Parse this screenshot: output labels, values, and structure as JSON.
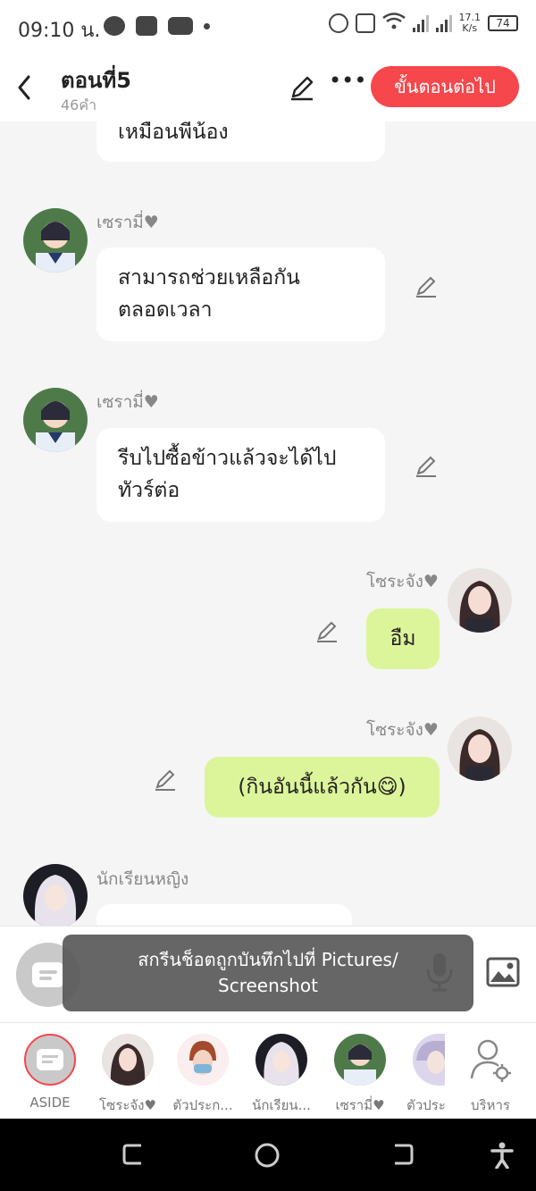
{
  "status_bar": {
    "time": "09:10 น.",
    "net_speed_value": "17.1",
    "net_speed_unit": "K/s",
    "battery": "74"
  },
  "header": {
    "title": "ตอนที่5",
    "subtitle": "46คำ",
    "next_button": "ขั้นตอนต่อไป"
  },
  "messages": [
    {
      "side": "left",
      "name": "",
      "text": "เหมือนพี่น้อง"
    },
    {
      "side": "left",
      "name": "เซรามี่♥",
      "line1": "สามารถช่วยเหลือกัน",
      "line2": "ตลอดเวลา"
    },
    {
      "side": "left",
      "name": "เซรามี่♥",
      "line1": "รีบไปซื้อข้าวแล้วจะได้ไป",
      "line2": "ทัวร์ต่อ"
    },
    {
      "side": "right",
      "name": "โซระจัง♥",
      "text": "อืม"
    },
    {
      "side": "right",
      "name": "โซระจัง♥",
      "text": "(กินอันนี้แล้วกัน😋)"
    },
    {
      "side": "left",
      "name": "นักเรียนหญิง",
      "text": ""
    }
  ],
  "input_bar": {
    "aside_label": "ASIDE"
  },
  "toast": {
    "line1": "สกรีนช็อตถูกบันทึกไปที่  Pictures/",
    "line2": "Screenshot"
  },
  "character_strip": [
    {
      "label": "ASIDE"
    },
    {
      "label": "โซระจัง♥"
    },
    {
      "label": "ตัวประก..."
    },
    {
      "label": "นักเรียน..."
    },
    {
      "label": "เซรามี่♥"
    },
    {
      "label": "ตัวประ"
    },
    {
      "label": "บริหาร"
    }
  ],
  "colors": {
    "accent": "#f5474c",
    "right_bubble": "#dcf59a",
    "background": "#f5f5f5"
  },
  "icons": [
    "back-icon",
    "pencil-icon",
    "more-icon",
    "mic-icon",
    "image-icon",
    "message-icon",
    "manage-characters-icon"
  ]
}
